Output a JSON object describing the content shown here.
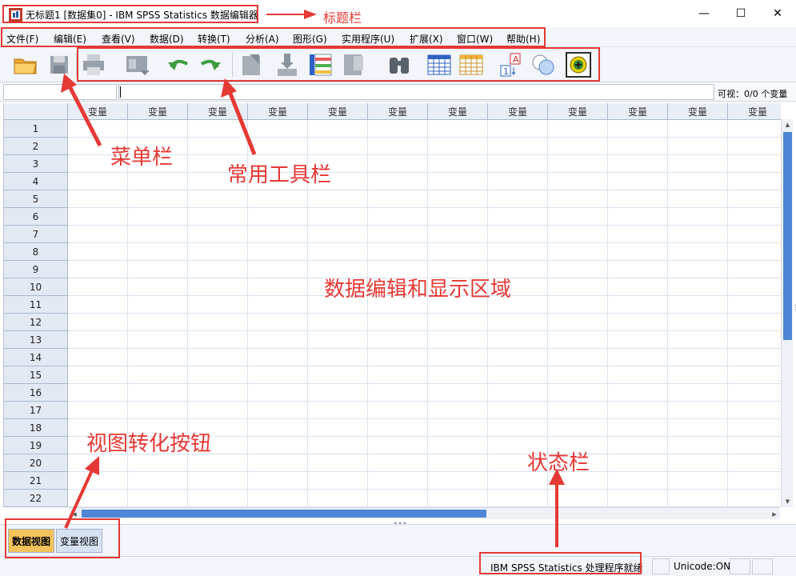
{
  "window": {
    "title": "无标题1 [数据集0] - IBM SPSS Statistics 数据编辑器",
    "minimize_glyph": "—",
    "maximize_glyph": "☐",
    "close_glyph": "✕"
  },
  "menu": {
    "items": [
      "文件(F)",
      "编辑(E)",
      "查看(V)",
      "数据(D)",
      "转换(T)",
      "分析(A)",
      "图形(G)",
      "实用程序(U)",
      "扩展(X)",
      "窗口(W)",
      "帮助(H)"
    ]
  },
  "toolbar": {
    "icons": [
      "open-folder-icon",
      "save-icon",
      "print-icon",
      "recall-dialog-icon",
      "undo-icon",
      "redo-icon",
      "goto-case-icon",
      "goto-variable-icon",
      "variables-icon",
      "run-descriptives-icon",
      "find-icon",
      "insert-cases-icon",
      "insert-variable-icon",
      "value-labels-icon",
      "use-variable-sets-icon",
      "customize-icon"
    ]
  },
  "cellbar": {
    "visible_label": "可视：0/0 个变量"
  },
  "grid": {
    "column_header": "变量",
    "column_count": 12,
    "row_numbers": [
      "1",
      "2",
      "3",
      "4",
      "5",
      "6",
      "7",
      "8",
      "9",
      "10",
      "11",
      "12",
      "13",
      "14",
      "15",
      "16",
      "17",
      "18",
      "19",
      "20",
      "21",
      "22"
    ]
  },
  "tabs": {
    "data_view": "数据视图",
    "variable_view": "变量视图"
  },
  "status": {
    "processor": "IBM SPSS Statistics 处理程序就绪",
    "unicode": "Unicode:ON"
  },
  "annotations": {
    "title_bar": "标题栏",
    "menu_bar": "菜单栏",
    "toolbar": "常用工具栏",
    "data_area": "数据编辑和显示区域",
    "view_switch": "视图转化按钮",
    "status_bar": "状态栏"
  },
  "colors": {
    "annotation_red": "#e53935",
    "scroll_blue": "#4f86d6",
    "active_tab": "#f3c35a"
  }
}
